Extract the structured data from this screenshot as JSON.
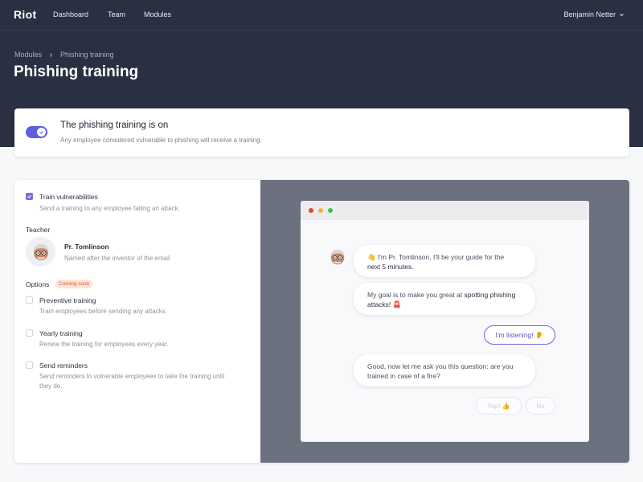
{
  "app": {
    "logo": "Riot",
    "nav": [
      "Dashboard",
      "Team",
      "Modules"
    ],
    "user_name": "Benjamin Netter"
  },
  "breadcrumb": [
    "Modules",
    "Phishing training"
  ],
  "page_title": "Phishing training",
  "status": {
    "enabled": true,
    "title": "The phishing training is on",
    "description": "Any employee considered vulnerable to phishing will receive a training."
  },
  "settings": {
    "train_vulnerabilities": {
      "checked": true,
      "label": "Train vulnerabilities",
      "description": "Send a training to any employee failing an attack."
    },
    "teacher": {
      "section_label": "Teacher",
      "name": "Pr. Tomlinson",
      "description": "Named after the inventor of the email"
    },
    "options": {
      "section_label": "Options",
      "badge": "Coming soon",
      "items": [
        {
          "checked": false,
          "label": "Preventive training",
          "description": "Train employees before sending any attacks."
        },
        {
          "checked": false,
          "label": "Yearly training",
          "description": "Renew the training for employees every year."
        },
        {
          "checked": false,
          "label": "Send reminders",
          "description_line1": "Send reminders to vulnerable employees to take the training until",
          "description_line2": "they do."
        }
      ]
    }
  },
  "preview": {
    "messages": [
      {
        "pre": "👋 I'm Pr. Tomlinson, I'll be your guide for the",
        "bold": "next 5 minutes."
      },
      {
        "pre": "My goal is to make you great at",
        "bold": "spotting phishing attacks!",
        "emoji": "🚨"
      },
      {
        "line1": "Good, now let me ask you this question: are you",
        "line2": "trained in case of a fire?"
      }
    ],
    "reply": "I'm listening! 👂",
    "answers": [
      "Yup! 👍",
      "No"
    ]
  },
  "colors": {
    "header_bg": "#283041",
    "accent": "#5b5fe0",
    "badge_bg": "#fde4d9",
    "badge_text": "#d8572a",
    "preview_bg": "#6b717f"
  }
}
